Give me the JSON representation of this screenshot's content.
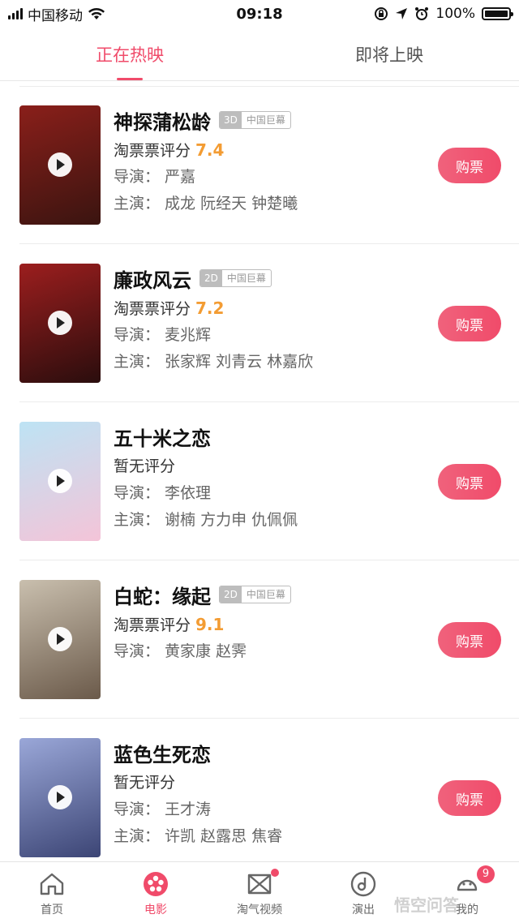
{
  "status_bar": {
    "carrier": "中国移动",
    "time": "09:18",
    "battery": "100%"
  },
  "tabs": [
    {
      "label": "正在热映",
      "active": true
    },
    {
      "label": "即将上映",
      "active": false
    }
  ],
  "movies": [
    {
      "title": "神探蒲松龄",
      "format": "3D",
      "screen": "中国巨幕",
      "rating_label": "淘票票评分",
      "rating": "7.4",
      "director": "导演：  严嘉",
      "cast": "主演：  成龙 阮经天 钟楚曦",
      "buy_label": "购票",
      "poster_colors": [
        "#8a1f1a",
        "#3a1410"
      ]
    },
    {
      "title": "廉政风云",
      "format": "2D",
      "screen": "中国巨幕",
      "rating_label": "淘票票评分",
      "rating": "7.2",
      "director": "导演：  麦兆辉",
      "cast": "主演：  张家辉 刘青云 林嘉欣",
      "buy_label": "购票",
      "poster_colors": [
        "#9c1e1e",
        "#2a0d0d"
      ]
    },
    {
      "title": "五十米之恋",
      "format": "",
      "screen": "",
      "rating_label": "暂无评分",
      "rating": "",
      "director": "导演：  李依理",
      "cast": "主演：  谢楠 方力申 仇佩佩",
      "buy_label": "购票",
      "poster_colors": [
        "#bde3f4",
        "#f4c4d8"
      ]
    },
    {
      "title": "白蛇：缘起",
      "format": "2D",
      "screen": "中国巨幕",
      "rating_label": "淘票票评分",
      "rating": "9.1",
      "director": "导演：  黄家康  赵霁",
      "cast": "",
      "buy_label": "购票",
      "poster_colors": [
        "#c9bfae",
        "#6b5a4a"
      ]
    },
    {
      "title": "蓝色生死恋",
      "format": "",
      "screen": "",
      "rating_label": "暂无评分",
      "rating": "",
      "director": "导演：  王才涛",
      "cast": "主演：  许凯 赵露思 焦睿",
      "buy_label": "购票",
      "poster_colors": [
        "#9aa7d8",
        "#3c4575"
      ]
    }
  ],
  "bottom_nav": [
    {
      "label": "首页",
      "icon": "home-icon",
      "active": false
    },
    {
      "label": "电影",
      "icon": "film-reel-icon",
      "active": true
    },
    {
      "label": "淘气视频",
      "icon": "video-icon",
      "active": false,
      "dot": true
    },
    {
      "label": "演出",
      "icon": "performance-icon",
      "active": false
    },
    {
      "label": "我的",
      "icon": "profile-icon",
      "active": false,
      "badge": "9"
    }
  ],
  "watermark": "悟空问答",
  "colors": {
    "accent": "#f04b6a",
    "score": "#f39c33"
  }
}
